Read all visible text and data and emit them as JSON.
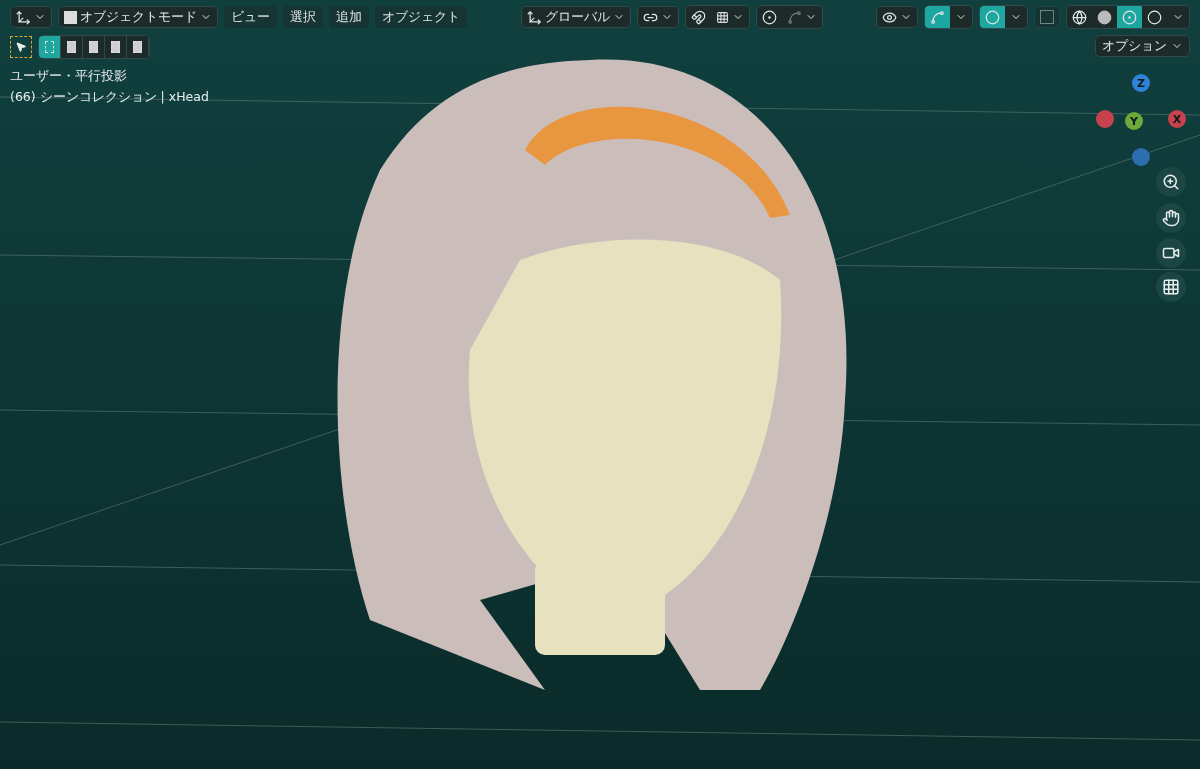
{
  "header": {
    "mode": "オブジェクトモード",
    "menus": [
      "ビュー",
      "選択",
      "追加",
      "オブジェクト"
    ],
    "orientation": "グローバル",
    "snap": {
      "on": false
    },
    "proportional": {
      "on": false
    },
    "gizmos": {
      "on": true
    },
    "overlays": {
      "on": true
    },
    "xray": {
      "on": false
    },
    "shading": [
      {
        "kind": "wireframe",
        "selected": false
      },
      {
        "kind": "solid",
        "selected": false
      },
      {
        "kind": "material",
        "selected": true
      },
      {
        "kind": "rendered",
        "selected": false
      }
    ]
  },
  "select_modes": [
    {
      "kind": "set",
      "selected": true
    },
    {
      "kind": "extend",
      "selected": false
    },
    {
      "kind": "subtract",
      "selected": false
    },
    {
      "kind": "invert",
      "selected": false
    },
    {
      "kind": "intersect",
      "selected": false
    }
  ],
  "options": "オプション",
  "viewport_info": [
    "ユーザー・平行投影",
    "(66) シーンコレクション | xHead"
  ],
  "gizmo": {
    "axes": [
      "Z",
      "Y",
      "X"
    ]
  }
}
